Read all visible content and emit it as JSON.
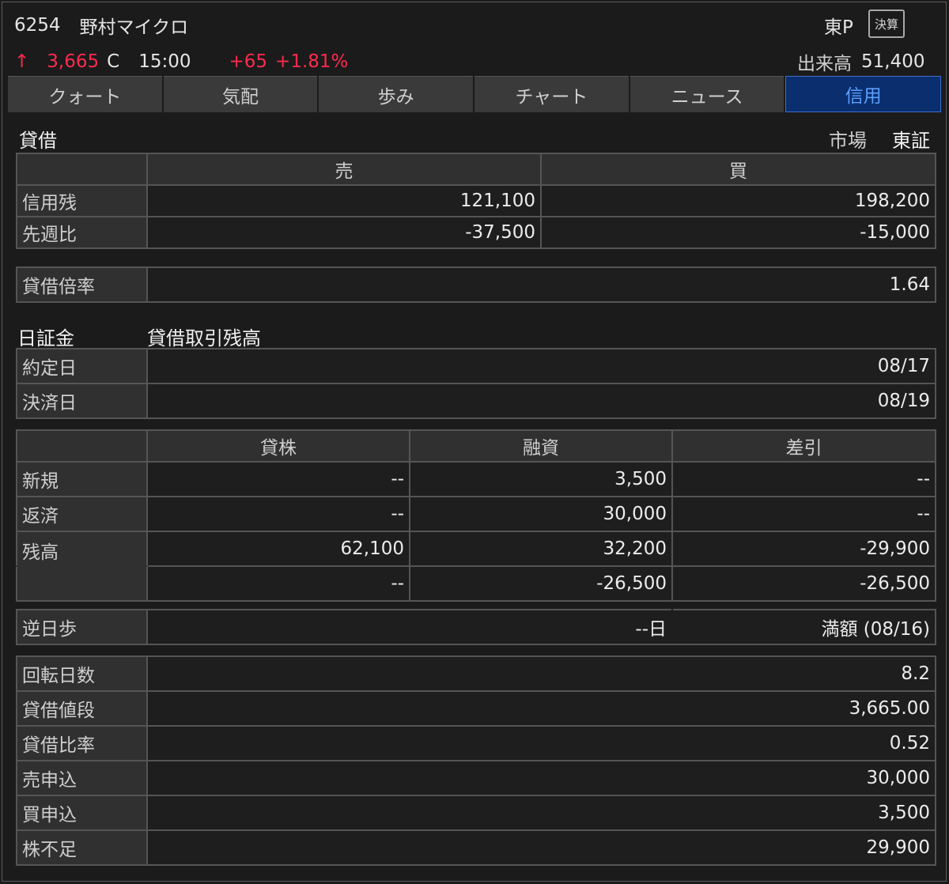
{
  "header": {
    "code": "6254",
    "name": "野村マイクロ",
    "market": "東P",
    "kessan_badge": "決算",
    "arrow": "↑",
    "price": "3,665",
    "price_flag": "C",
    "time": "15:00",
    "change": "+65",
    "change_pct": "+1.81%",
    "volume_label": "出来高",
    "volume": "51,400"
  },
  "tabs": [
    "クォート",
    "気配",
    "歩み",
    "チャート",
    "ニュース",
    "信用"
  ],
  "active_tab": 5,
  "margin": {
    "title": "貸借",
    "market_label": "市場",
    "market_value": "東証",
    "col_sell": "売",
    "col_buy": "買",
    "rows": [
      {
        "label": "信用残",
        "sell": "121,100",
        "buy": "198,200"
      },
      {
        "label": "先週比",
        "sell": "-37,500",
        "buy": "-15,000"
      }
    ],
    "ratio_label": "貸借倍率",
    "ratio_value": "1.64"
  },
  "jsf": {
    "title": "日証金",
    "subtitle": "貸借取引残高",
    "dates": [
      {
        "label": "約定日",
        "value": "08/17"
      },
      {
        "label": "決済日",
        "value": "08/19"
      }
    ],
    "col_lend": "貸株",
    "col_loan": "融資",
    "col_diff": "差引",
    "rows": [
      {
        "label": "新規",
        "lend": "--",
        "loan": "3,500",
        "diff": "--"
      },
      {
        "label": "返済",
        "lend": "--",
        "loan": "30,000",
        "diff": "--"
      },
      {
        "label": "残高",
        "lend": "62,100",
        "loan": "32,200",
        "diff": "-29,900"
      },
      {
        "label": "",
        "lend": "--",
        "loan": "-26,500",
        "diff": "-26,500"
      }
    ],
    "gyakuhibu_label": "逆日歩",
    "gyakuhibu_days": "--日",
    "gyakuhibu_full": "満額 (08/16)",
    "stats": [
      {
        "label": "回転日数",
        "value": "8.2"
      },
      {
        "label": "貸借値段",
        "value": "3,665.00"
      },
      {
        "label": "貸借比率",
        "value": "0.52"
      },
      {
        "label": "売申込",
        "value": "30,000"
      },
      {
        "label": "買申込",
        "value": "3,500"
      },
      {
        "label": "株不足",
        "value": "29,900"
      }
    ]
  },
  "colors": {
    "up": "#ff2a4d",
    "negative": "#1fd4c0",
    "active_tab_bg": "#0a2e6e",
    "active_tab_text": "#5aa0ff"
  }
}
